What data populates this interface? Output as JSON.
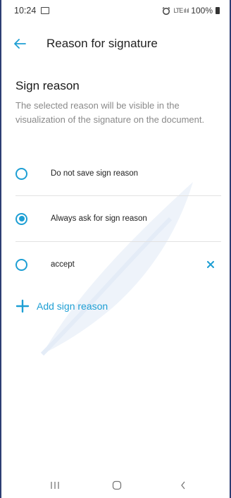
{
  "status_bar": {
    "time": "10:24",
    "signal_text": "LTE ıl ıl",
    "battery": "100%"
  },
  "app_bar": {
    "title": "Reason for signature"
  },
  "section": {
    "title": "Sign reason",
    "description": "The selected reason will be visible in the visualization of the signature on the document."
  },
  "options": [
    {
      "label": "Do not save sign reason",
      "selected": false,
      "deletable": false
    },
    {
      "label": "Always ask for sign reason",
      "selected": true,
      "deletable": false
    },
    {
      "label": "accept",
      "selected": false,
      "deletable": true
    }
  ],
  "add_button": {
    "label": "Add sign reason"
  },
  "colors": {
    "accent": "#1e9fd4",
    "frame_border": "#2d3e73",
    "watermark": "#eef3fa"
  },
  "icons": {
    "back": "arrow-left-icon",
    "delete": "close-icon",
    "add": "plus-icon",
    "nav_recent": "recent-apps-icon",
    "nav_home": "home-icon",
    "nav_back": "chevron-left-icon"
  }
}
